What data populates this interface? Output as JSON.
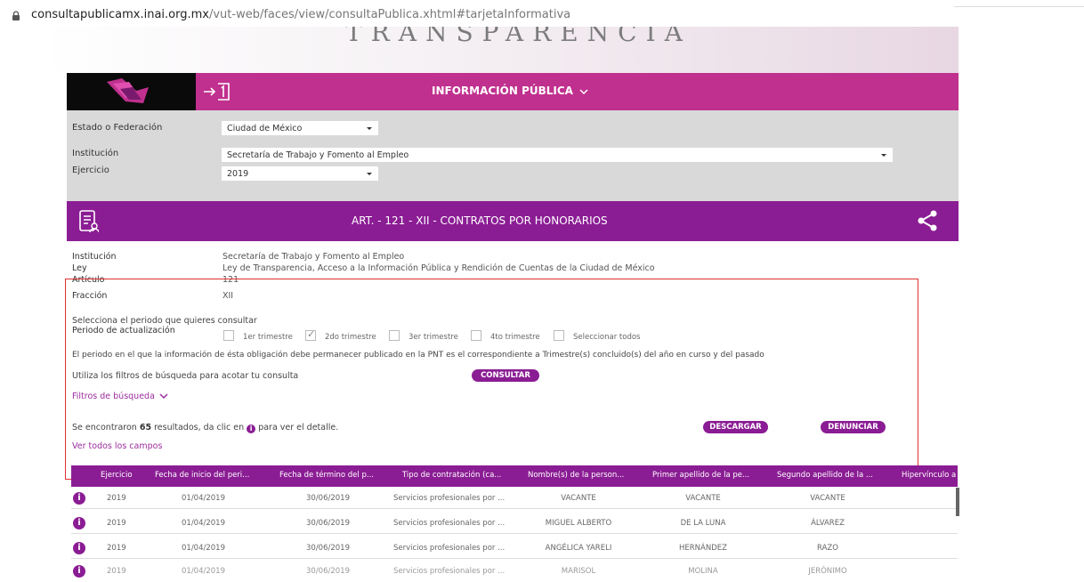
{
  "browser": {
    "url_host": "consultapublicamx.inai.org.mx",
    "url_path": "/vut-web/faces/view/consultaPublica.xhtml#tarjetaInformativa"
  },
  "banner": {
    "title": "TRANSPARENCIA"
  },
  "nav": {
    "menu_label": "INFORMACIÓN PÚBLICA",
    "menu_icon": "chevron-down-icon"
  },
  "filters": {
    "estado_label": "Estado o Federación",
    "estado_value": "Ciudad de México",
    "institucion_label": "Institución",
    "institucion_value": "Secretaría de Trabajo y Fomento al Empleo",
    "ejercicio_label": "Ejercicio",
    "ejercicio_value": "2019"
  },
  "article": {
    "title": "ART. - 121 - XII - CONTRATOS POR HONORARIOS"
  },
  "info": {
    "institucion_label": "Institución",
    "institucion_value": "Secretaría de Trabajo y Fomento al Empleo",
    "ley_label": "Ley",
    "ley_value": "Ley de Transparencia, Acceso a la Información Pública y Rendición de Cuentas de la Ciudad de México",
    "articulo_label": "Artículo",
    "articulo_value": "121",
    "fraccion_label": "Fracción",
    "fraccion_value": "XII"
  },
  "periodo": {
    "prompt": "Selecciona el periodo que quieres consultar",
    "label": "Periodo de actualización",
    "options": [
      {
        "label": "1er trimestre",
        "checked": false
      },
      {
        "label": "2do trimestre",
        "checked": true
      },
      {
        "label": "3er trimestre",
        "checked": false
      },
      {
        "label": "4to trimestre",
        "checked": false
      },
      {
        "label": "Seleccionar todos",
        "checked": false
      }
    ],
    "note": "El periodo en el que la información de ésta obligación debe permanecer publicado en la PNT es el correspondiente a Trimestre(s) concluido(s) del año en curso y del pasado"
  },
  "search": {
    "hint": "Utiliza los filtros de búsqueda para acotar tu consulta",
    "consultar_label": "CONSULTAR",
    "filters_link": "Filtros de búsqueda"
  },
  "results": {
    "prefix": "Se encontraron",
    "count": "65",
    "suffix_before_icon": "resultados, da clic en",
    "suffix_after_icon": "para ver el detalle.",
    "descargar_label": "DESCARGAR",
    "denunciar_label": "DENUNCIAR",
    "ver_todos": "Ver todos los campos"
  },
  "table": {
    "headers": [
      "Ejercicio",
      "Fecha de inicio del peri...",
      "Fecha de término del p...",
      "Tipo de contratación (ca...",
      "Nombre(s) de la person...",
      "Primer apellido de la pe...",
      "Segundo apellido de la ...",
      "Hipervínculo a"
    ],
    "rows": [
      [
        "2019",
        "01/04/2019",
        "30/06/2019",
        "Servicios profesionales por ...",
        "VACANTE",
        "VACANTE",
        "VACANTE"
      ],
      [
        "2019",
        "01/04/2019",
        "30/06/2019",
        "Servicios profesionales por ...",
        "MIGUEL ALBERTO",
        "DE LA LUNA",
        "ÁLVAREZ"
      ],
      [
        "2019",
        "01/04/2019",
        "30/06/2019",
        "Servicios profesionales por ...",
        "ANGÉLICA YARELI",
        "HERNÁNDEZ",
        "RAZO"
      ],
      [
        "2019",
        "01/04/2019",
        "30/06/2019",
        "Servicios profesionales por ...",
        "MARISOL",
        "MOLINA",
        "JERÓNIMO"
      ]
    ]
  },
  "colors": {
    "magenta": "#c0308e",
    "purple": "#8b1d94",
    "red_outline": "#e03030"
  }
}
